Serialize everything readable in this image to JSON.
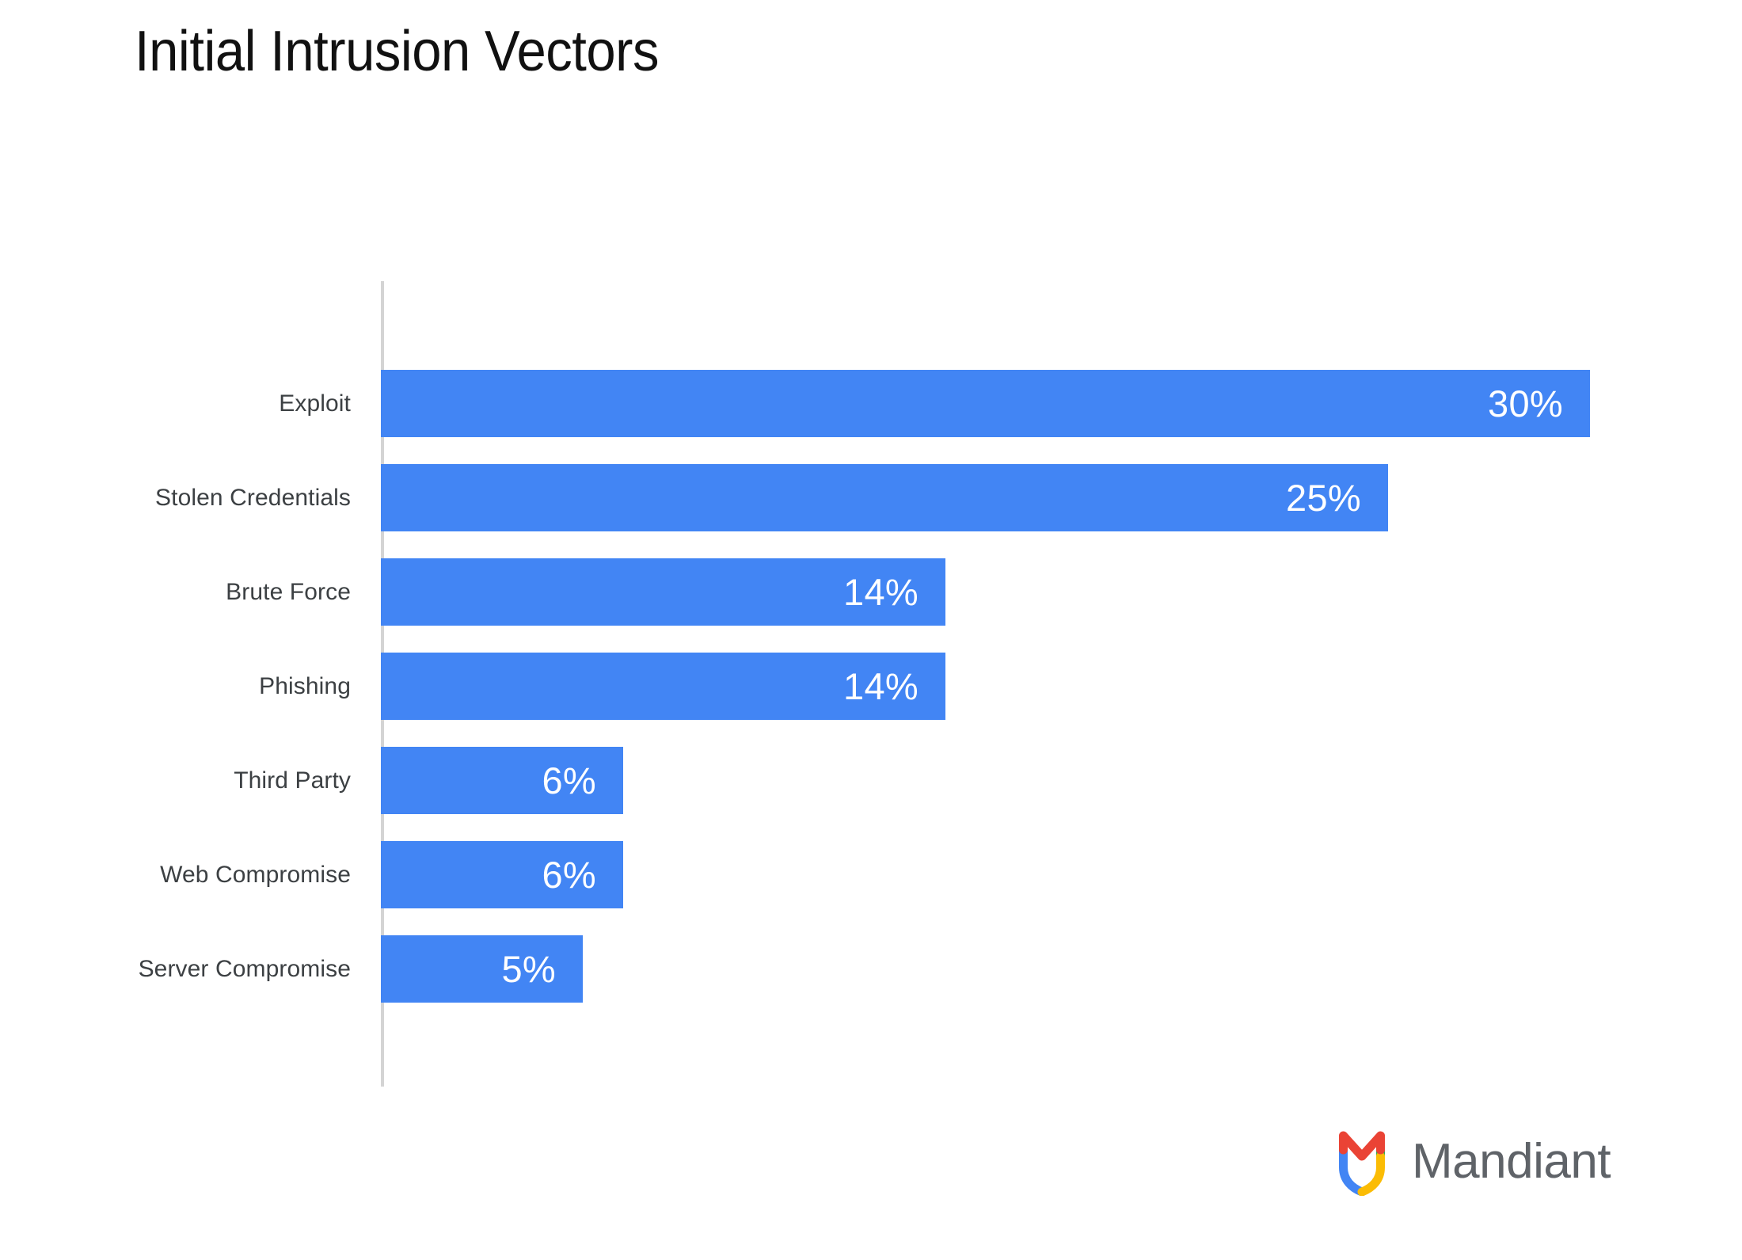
{
  "chart_data": {
    "type": "bar",
    "orientation": "horizontal",
    "title": "Initial Intrusion Vectors",
    "subtitle": "",
    "xlabel": "",
    "ylabel": "",
    "categories": [
      "Exploit",
      "Stolen Credentials",
      "Brute Force",
      "Phishing",
      "Third Party",
      "Web Compromise",
      "Server Compromise"
    ],
    "values": [
      30,
      25,
      14,
      14,
      6,
      6,
      5
    ],
    "value_labels": [
      "30%",
      "25%",
      "14%",
      "14%",
      "6%",
      "6%",
      "5%"
    ],
    "unit": "%",
    "xlim": [
      0,
      33.5
    ],
    "grid": false,
    "legend": null,
    "bar_color": "#4285f4",
    "value_label_color": "#ffffff",
    "category_label_color": "#3c4043",
    "axis_line_color": "#d4d4d4",
    "background": "#ffffff",
    "bars": [
      {
        "category": "Exploit",
        "value": 30,
        "label": "30%"
      },
      {
        "category": "Stolen Credentials",
        "value": 25,
        "label": "25%"
      },
      {
        "category": "Brute Force",
        "value": 14,
        "label": "14%"
      },
      {
        "category": "Phishing",
        "value": 14,
        "label": "14%"
      },
      {
        "category": "Third Party",
        "value": 6,
        "label": "6%"
      },
      {
        "category": "Web Compromise",
        "value": 6,
        "label": "6%"
      },
      {
        "category": "Server Compromise",
        "value": 5,
        "label": "5%"
      }
    ]
  },
  "branding": {
    "logo_icon": "mandiant-shield-icon",
    "wordmark": "Mandiant",
    "wordmark_color": "#5f6368",
    "mark_colors": {
      "red": "#ea4335",
      "blue": "#4285f4",
      "yellow": "#fbbc04",
      "green": "#34a853"
    }
  }
}
